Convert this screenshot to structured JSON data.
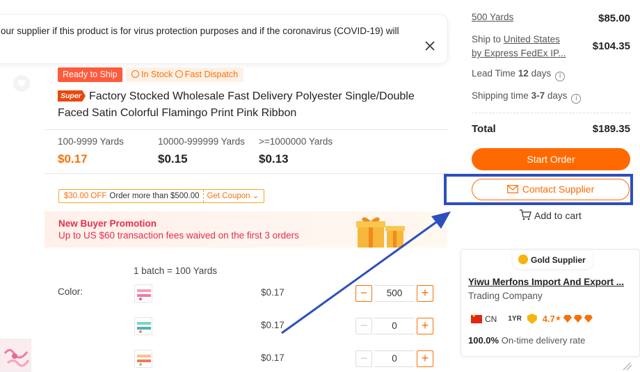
{
  "notice": {
    "text": "our supplier if this product is for virus protection purposes and if the coronavirus (COVID-19) will"
  },
  "tags": {
    "ready": "Ready to Ship",
    "stock": "In Stock",
    "dispatch": "Fast Dispatch"
  },
  "product": {
    "badge": "Super",
    "title": "Factory Stocked Wholesale Fast Delivery Polyester Single/Double Faced Satin Colorful Flamingo Print Pink Ribbon"
  },
  "tiers": [
    {
      "qty": "100-9999 Yards",
      "price": "$0.17"
    },
    {
      "qty": "10000-999999 Yards",
      "price": "$0.15"
    },
    {
      "qty": ">=1000000 Yards",
      "price": "$0.13"
    }
  ],
  "coupon": {
    "off": "$30.00 OFF",
    "condition": "Order more than $500.00",
    "get": "Get Coupon"
  },
  "promo": {
    "title": "New Buyer Promotion",
    "sub": "Up to US $60 transaction fees waived on the first 3 orders"
  },
  "batch": "1 batch = 100 Yards",
  "color_label": "Color:",
  "variants": [
    {
      "price": "$0.17",
      "qty": "500"
    },
    {
      "price": "$0.17",
      "qty": "0"
    },
    {
      "price": "$0.17",
      "qty": "0"
    }
  ],
  "summary": {
    "yards_label": "500 Yards",
    "yards_value": "$85.00",
    "ship_to_prefix": "Ship to ",
    "ship_to_country": "United States",
    "ship_by": "by Express FedEx IP...",
    "ship_value": "$104.35",
    "lead_prefix": "Lead Time ",
    "lead_value": "12",
    "lead_suffix": " days",
    "shipping_prefix": "Shipping time ",
    "shipping_value": "3-7",
    "shipping_suffix": " days",
    "total_label": "Total",
    "total_value": "$189.35"
  },
  "actions": {
    "start": "Start Order",
    "contact": "Contact Supplier",
    "cart": "Add to cart"
  },
  "supplier": {
    "badge": "Gold Supplier",
    "name": "Yiwu Merfons Import And Export ...",
    "type": "Trading Company",
    "country": "CN",
    "years": "1YR",
    "rating": "4.7",
    "rate_value": "100.0%",
    "rate_label": " On-time delivery rate"
  },
  "colors": {
    "accent": "#ff6a00",
    "promo": "#e52e4a",
    "highlight": "#2c4fbd"
  }
}
